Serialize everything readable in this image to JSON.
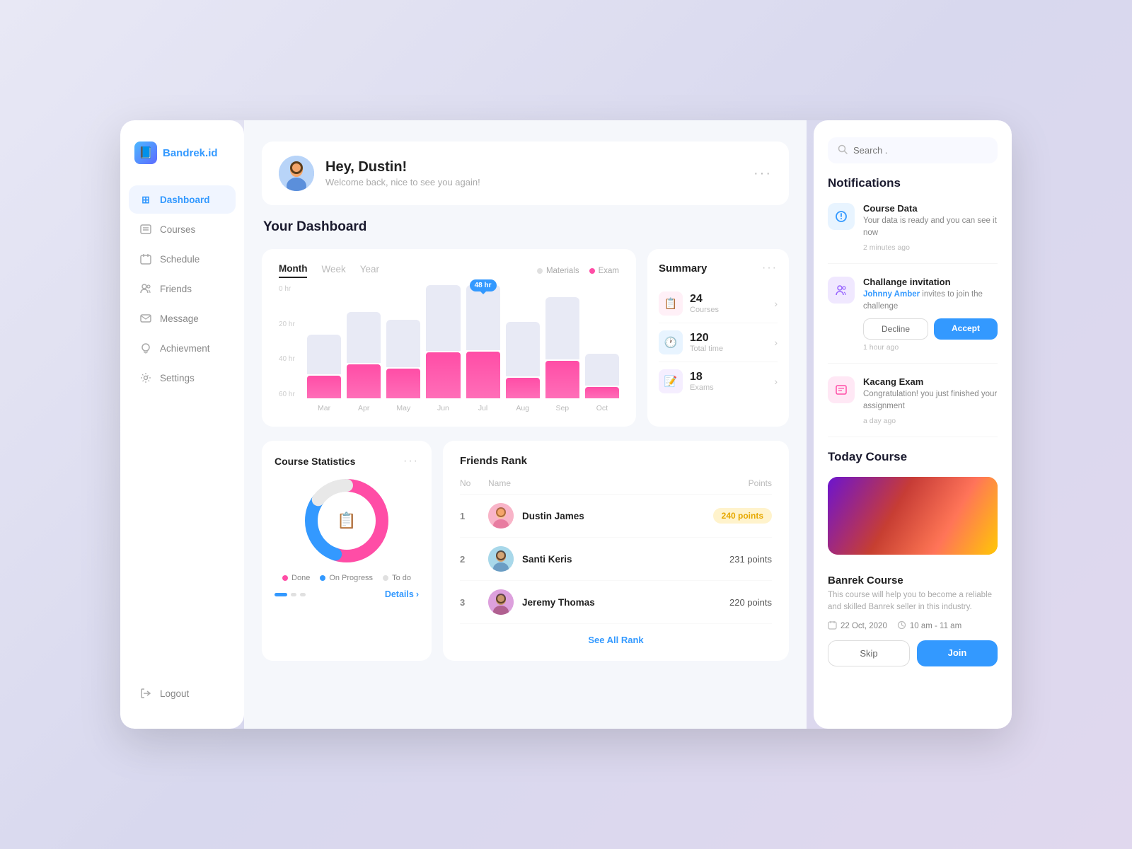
{
  "app": {
    "name": "Bandrek.id"
  },
  "sidebar": {
    "logo_label": "Bandrek.id",
    "nav_items": [
      {
        "id": "dashboard",
        "label": "Dashboard",
        "icon": "⊞",
        "active": true
      },
      {
        "id": "courses",
        "label": "Courses",
        "icon": "📋",
        "active": false
      },
      {
        "id": "schedule",
        "label": "Schedule",
        "icon": "📅",
        "active": false
      },
      {
        "id": "friends",
        "label": "Friends",
        "icon": "👥",
        "active": false
      },
      {
        "id": "message",
        "label": "Message",
        "icon": "✉",
        "active": false
      },
      {
        "id": "achievement",
        "label": "Achievment",
        "icon": "⚙",
        "active": false
      },
      {
        "id": "settings",
        "label": "Settings",
        "icon": "⚙",
        "active": false
      }
    ],
    "logout_label": "Logout"
  },
  "header": {
    "greeting": "Hey, Dustin!",
    "subtitle": "Welcome back, nice to see you again!"
  },
  "dashboard": {
    "title": "Your Dashboard"
  },
  "chart": {
    "tabs": [
      "Month",
      "Week",
      "Year"
    ],
    "active_tab": "Month",
    "legend": {
      "materials_label": "Materials",
      "exam_label": "Exam"
    },
    "y_labels": [
      "60 hr",
      "40 hr",
      "20 hr",
      "0 hr"
    ],
    "x_labels": [
      "Mar",
      "Apr",
      "May",
      "Jun",
      "Jul",
      "Aug",
      "Sep",
      "Oct"
    ],
    "tooltip": "48 hr",
    "bars": [
      {
        "bg_h": 35,
        "pink_h": 20
      },
      {
        "bg_h": 45,
        "pink_h": 32
      },
      {
        "bg_h": 42,
        "pink_h": 28
      },
      {
        "bg_h": 60,
        "pink_h": 45
      },
      {
        "bg_h": 80,
        "pink_h": 60,
        "has_tooltip": true
      },
      {
        "bg_h": 48,
        "pink_h": 20
      },
      {
        "bg_h": 55,
        "pink_h": 35
      },
      {
        "bg_h": 30,
        "pink_h": 12
      }
    ]
  },
  "summary": {
    "title": "Summary",
    "items": [
      {
        "num": "24",
        "label": "Courses",
        "icon": "📋",
        "icon_bg": "pink"
      },
      {
        "num": "120",
        "label": "Total time",
        "icon": "🕐",
        "icon_bg": "blue"
      },
      {
        "num": "18",
        "label": "Exams",
        "icon": "📝",
        "icon_bg": "purple"
      }
    ]
  },
  "course_stats": {
    "title": "Course Statistics",
    "legend": [
      {
        "label": "Done",
        "color": "#ff4da6"
      },
      {
        "label": "On Progress",
        "color": "#3399ff"
      },
      {
        "label": "To do",
        "color": "#e0e0e0"
      }
    ],
    "details_label": "Details",
    "donut": {
      "done_pct": 55,
      "progress_pct": 30,
      "todo_pct": 15
    }
  },
  "friends_rank": {
    "title": "Friends Rank",
    "cols": [
      "No",
      "Name",
      "Points"
    ],
    "rows": [
      {
        "no": 1,
        "name": "Dustin James",
        "points": "240 points",
        "is_top": true
      },
      {
        "no": 2,
        "name": "Santi Keris",
        "points": "231 points",
        "is_top": false
      },
      {
        "no": 3,
        "name": "Jeremy Thomas",
        "points": "220 points",
        "is_top": false
      }
    ],
    "see_all_label": "See All Rank"
  },
  "right_panel": {
    "search_placeholder": "Search .",
    "notifications_title": "Notifications",
    "notifications": [
      {
        "id": "course-data",
        "icon_type": "blue",
        "icon": "🕐",
        "title": "Course Data",
        "desc": "Your data is ready and you can see it now",
        "time": "2 minutes ago",
        "has_actions": false
      },
      {
        "id": "challenge",
        "icon_type": "purple",
        "icon": "👥",
        "title": "Challange invitation",
        "desc": "Johnny Amber invites to join the challenge",
        "time": "1 hour ago",
        "has_actions": true,
        "decline_label": "Decline",
        "accept_label": "Accept"
      },
      {
        "id": "kacang-exam",
        "icon_type": "pink",
        "icon": "📝",
        "title": "Kacang Exam",
        "desc": "Congratulation! you just finished your assignment",
        "time": "a day ago",
        "has_actions": false
      }
    ],
    "today_course_title": "Today Course",
    "course": {
      "name": "Banrek Course",
      "desc": "This course will help you to become a reliable and skilled Banrek seller in this industry.",
      "date": "22 Oct, 2020",
      "time": "10 am - 11 am",
      "skip_label": "Skip",
      "join_label": "Join"
    }
  }
}
